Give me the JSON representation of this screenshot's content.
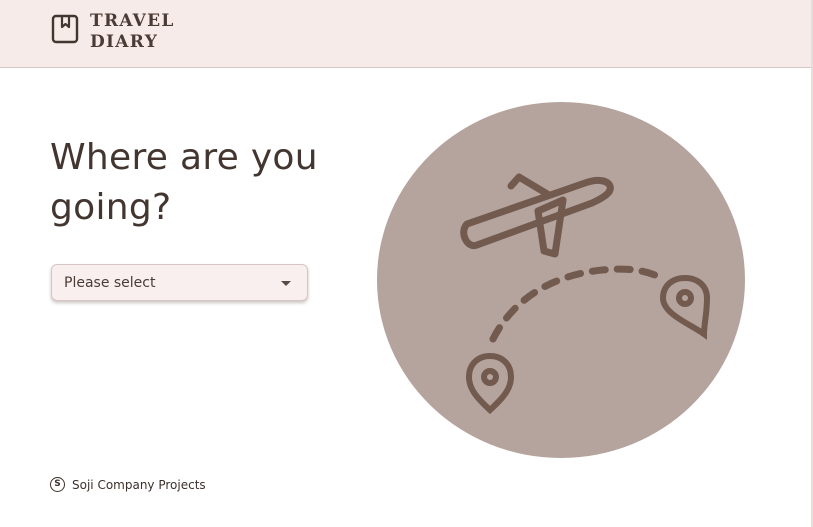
{
  "brand": {
    "line1": "TRAVEL",
    "line2": "DIARY",
    "icon": "bookmark-book-icon"
  },
  "hero": {
    "title_line1": "Where are you",
    "title_line2": "going?"
  },
  "destination_select": {
    "selected": "Please select",
    "icon": "caret-down-icon"
  },
  "illustration": {
    "description_icons": [
      "airplane-icon",
      "dashed-route",
      "location-pin-icon"
    ]
  },
  "footer": {
    "badge": "S",
    "text": "Soji Company Projects"
  },
  "colors": {
    "header_bg": "#f6ebe8",
    "text_dark": "#43352f",
    "circle": "#b4a49d",
    "icon_brown": "#735a4f",
    "select_bg": "#f9efee"
  }
}
